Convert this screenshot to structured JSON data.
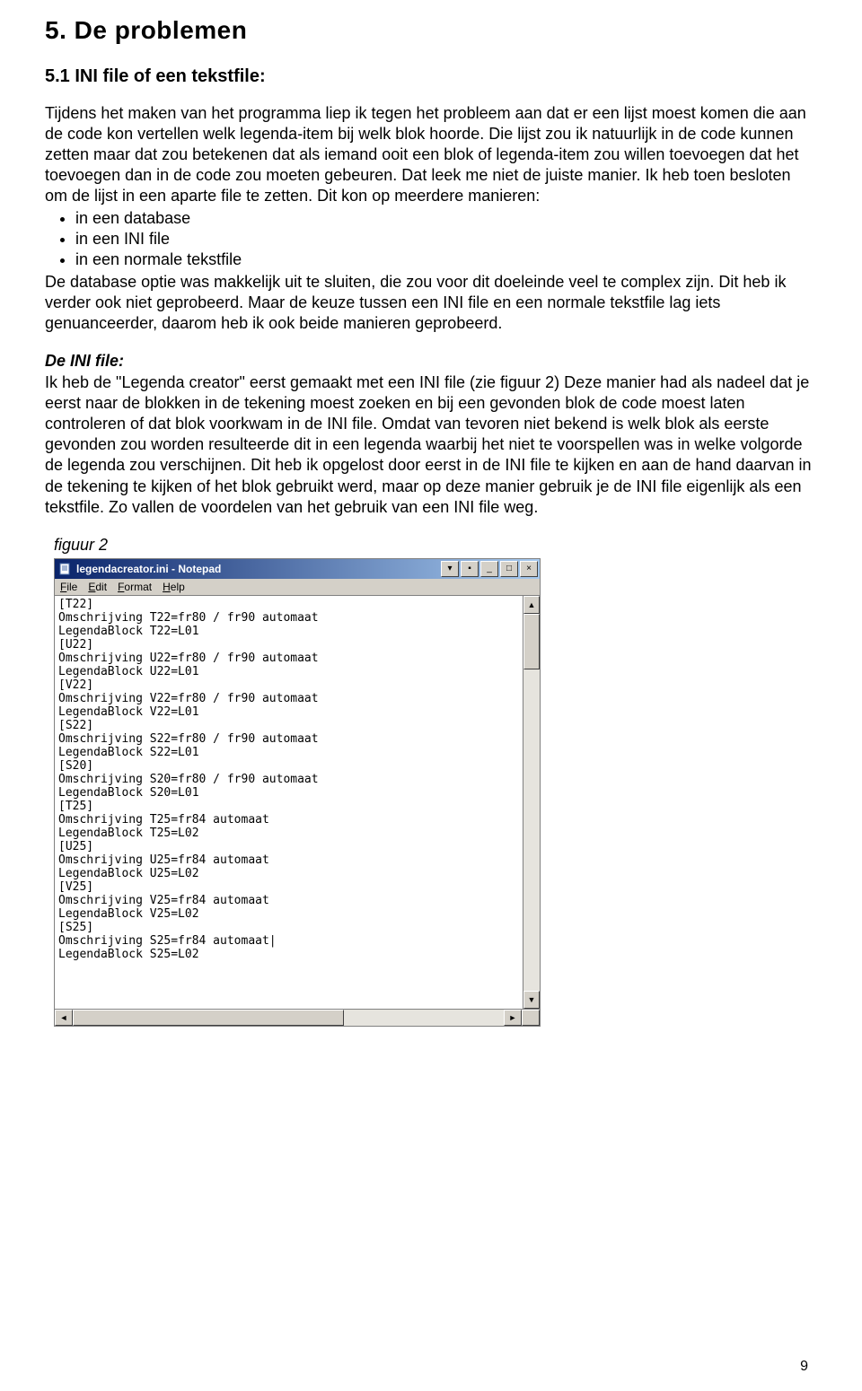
{
  "headings": {
    "h1": "5.   De problemen",
    "h2": "5.1  INI file of een tekstfile:"
  },
  "body": {
    "p1": "Tijdens het maken van het programma liep ik tegen het probleem aan dat er een lijst moest komen die aan de code kon vertellen welk legenda-item bij welk blok hoorde. Die lijst zou ik natuurlijk in de code kunnen zetten maar dat zou betekenen dat als iemand ooit een blok of legenda-item zou willen toevoegen dat het toevoegen dan in de code zou moeten gebeuren. Dat leek me niet de juiste manier. Ik heb toen besloten om de lijst in een aparte file te zetten. Dit kon op meerdere manieren:",
    "bullets": [
      "in een database",
      "in een INI file",
      "in een normale tekstfile"
    ],
    "p2": "De database optie was makkelijk uit te sluiten, die zou voor dit doeleinde veel te complex zijn. Dit heb ik verder ook niet geprobeerd. Maar de keuze tussen een INI file en een normale tekstfile lag iets genuanceerder, daarom heb ik ook beide manieren geprobeerd.",
    "ini_title": "De INI file:",
    "p3": "Ik heb de \"Legenda creator\" eerst gemaakt met een INI file (zie figuur 2) Deze manier had als nadeel dat je eerst naar de blokken in de tekening moest zoeken en bij een gevonden blok de code moest laten controleren of dat blok voorkwam in de INI file. Omdat van tevoren niet bekend is welk blok als eerste gevonden zou worden resulteerde dit in een legenda waarbij het niet te voorspellen was in welke volgorde de legenda zou verschijnen. Dit heb ik opgelost door eerst in de INI file te kijken en aan de hand daarvan in de tekening te kijken of het blok gebruikt werd, maar op deze manier gebruik je de INI file eigenlijk als een tekstfile. Zo vallen de voordelen van het gebruik van een INI file weg.",
    "fig_label": "figuur 2"
  },
  "notepad": {
    "title": "legendacreator.ini - Notepad",
    "menus": [
      "File",
      "Edit",
      "Format",
      "Help"
    ],
    "lines": [
      "[T22]",
      "Omschrijving T22=fr80 / fr90 automaat",
      "LegendaBlock T22=L01",
      "[U22]",
      "Omschrijving U22=fr80 / fr90 automaat",
      "LegendaBlock U22=L01",
      "[V22]",
      "Omschrijving V22=fr80 / fr90 automaat",
      "LegendaBlock V22=L01",
      "[S22]",
      "Omschrijving S22=fr80 / fr90 automaat",
      "LegendaBlock S22=L01",
      "[S20]",
      "Omschrijving S20=fr80 / fr90 automaat",
      "LegendaBlock S20=L01",
      "[T25]",
      "Omschrijving T25=fr84 automaat",
      "LegendaBlock T25=L02",
      "[U25]",
      "Omschrijving U25=fr84 automaat",
      "LegendaBlock U25=L02",
      "[V25]",
      "Omschrijving V25=fr84 automaat",
      "LegendaBlock V25=L02",
      "[S25]",
      "Omschrijving S25=fr84 automaat|",
      "LegendaBlock S25=L02"
    ]
  },
  "page_number": "9"
}
